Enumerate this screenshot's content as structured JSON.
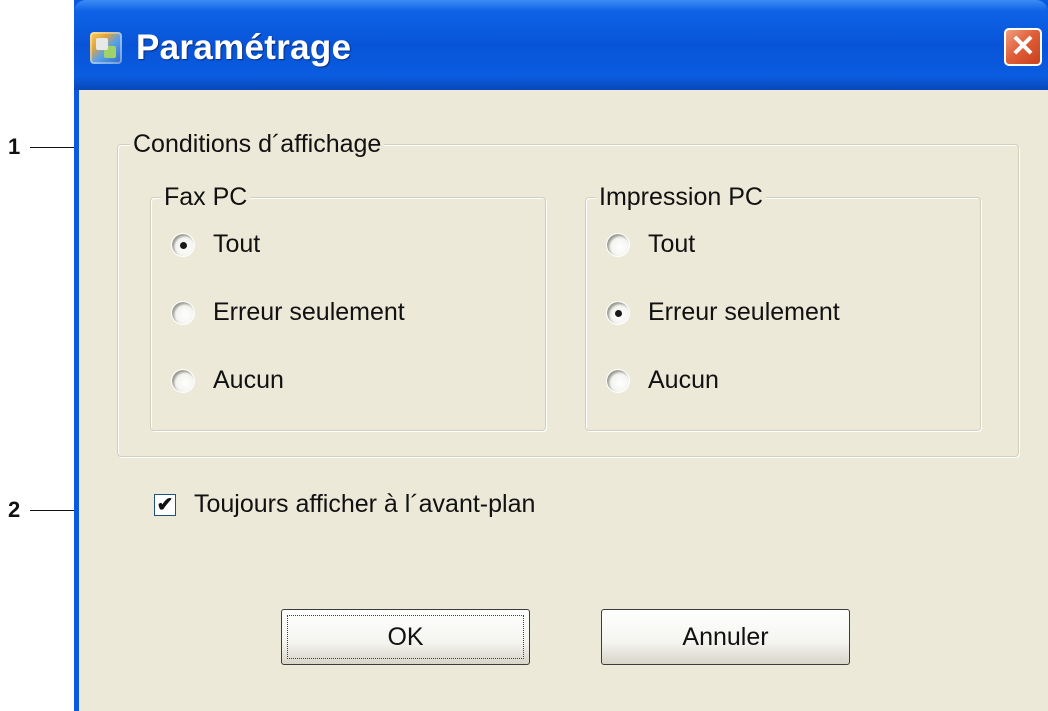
{
  "window": {
    "title": "Paramétrage",
    "close_glyph": "✕"
  },
  "display_conditions": {
    "legend": "Conditions d´affichage",
    "fax_pc": {
      "legend": "Fax PC",
      "options": [
        "Tout",
        "Erreur seulement",
        "Aucun"
      ],
      "selected": "Tout"
    },
    "impression_pc": {
      "legend": "Impression PC",
      "options": [
        "Tout",
        "Erreur seulement",
        "Aucun"
      ],
      "selected": "Erreur seulement"
    }
  },
  "always_on_top": {
    "label": "Toujours afficher à l´avant-plan",
    "checked": true,
    "check_glyph": "✔"
  },
  "buttons": {
    "ok": "OK",
    "cancel": "Annuler"
  },
  "callouts": {
    "one": "1",
    "two": "2"
  },
  "icons": {
    "app": "settings-app-icon",
    "close": "close-icon"
  },
  "colors": {
    "titlebar": "#0854d8",
    "client": "#ece9d8",
    "close": "#e0603a"
  }
}
